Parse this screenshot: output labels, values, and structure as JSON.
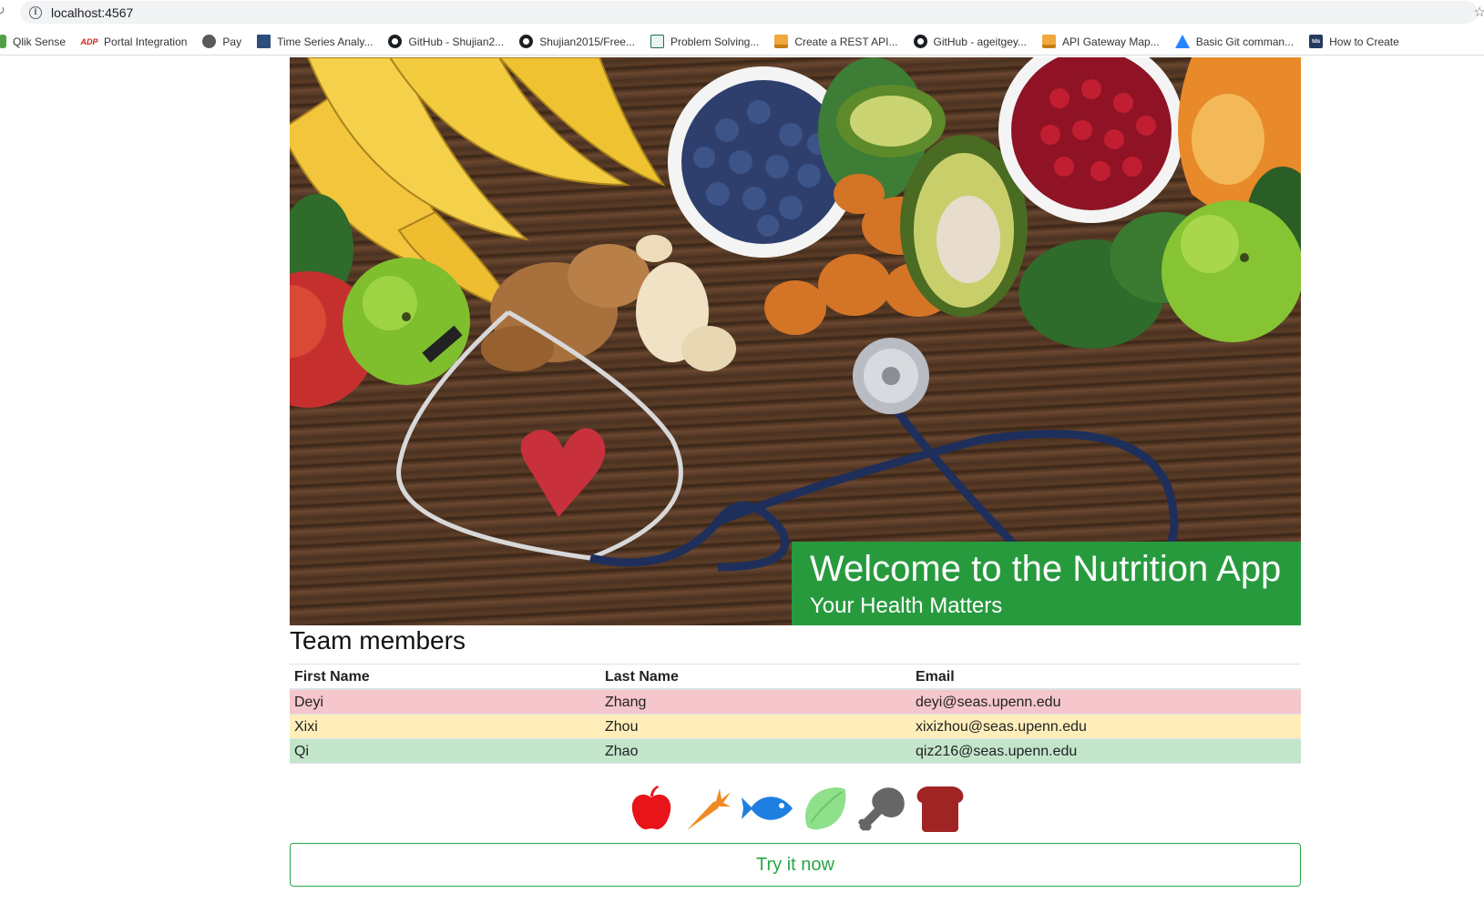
{
  "browser": {
    "url": "localhost:4567",
    "bookmarks": [
      {
        "label": "Qlik Sense",
        "icon": "qlik-icon"
      },
      {
        "label": "Portal Integration",
        "icon": "adp-icon"
      },
      {
        "label": "Pay",
        "icon": "globe-icon"
      },
      {
        "label": "Time Series Analy...",
        "icon": "document-icon"
      },
      {
        "label": "GitHub - Shujian2...",
        "icon": "github-icon"
      },
      {
        "label": "Shujian2015/Free...",
        "icon": "github-icon"
      },
      {
        "label": "Problem Solving...",
        "icon": "chart-icon"
      },
      {
        "label": "Create a REST API...",
        "icon": "aws-box-icon"
      },
      {
        "label": "GitHub - ageitgey...",
        "icon": "github-icon"
      },
      {
        "label": "API Gateway Map...",
        "icon": "aws-box-icon"
      },
      {
        "label": "Basic Git comman...",
        "icon": "atlassian-icon"
      },
      {
        "label": "How to Create",
        "icon": "tds-icon"
      }
    ],
    "adp_badge": "ADP",
    "tds_badge": "tds"
  },
  "hero": {
    "title": "Welcome to the Nutrition App",
    "subtitle": "Your Health Matters",
    "image_subject": "fruits-vegetables-stethoscope-heart-photo",
    "banner_color": "#289a3e"
  },
  "team": {
    "heading": "Team members",
    "columns": [
      "First Name",
      "Last Name",
      "Email"
    ],
    "rows": [
      {
        "first": "Deyi",
        "last": "Zhang",
        "email": "deyi@seas.upenn.edu",
        "color": "#f5c6cb"
      },
      {
        "first": "Xixi",
        "last": "Zhou",
        "email": "xixizhou@seas.upenn.edu",
        "color": "#ffeeba"
      },
      {
        "first": "Qi",
        "last": "Zhao",
        "email": "qiz216@seas.upenn.edu",
        "color": "#c3e6cb"
      }
    ]
  },
  "food_icons": [
    {
      "name": "apple-icon",
      "color": "#e8141a"
    },
    {
      "name": "carrot-icon",
      "color": "#f08a24"
    },
    {
      "name": "fish-icon",
      "color": "#1e7fe0"
    },
    {
      "name": "lime-icon",
      "color": "#8ee08a"
    },
    {
      "name": "drumstick-icon",
      "color": "#666666"
    },
    {
      "name": "bread-icon",
      "color": "#a12424"
    }
  ],
  "cta": {
    "label": "Try it now",
    "color": "#28a745"
  }
}
